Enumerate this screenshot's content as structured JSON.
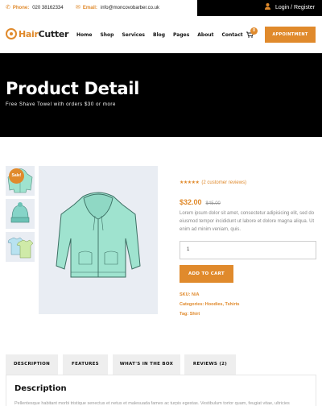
{
  "topbar": {
    "phone_label": "Phone:",
    "phone_value": "020 38162334",
    "email_label": "Email:",
    "email_value": "info@moncovobarber.co.uk",
    "login_text": "Login / Register"
  },
  "brand": {
    "name_part1": "Hair",
    "name_part2": "Cutter"
  },
  "nav": {
    "items": [
      "Home",
      "Shop",
      "Services",
      "Blog",
      "Pages",
      "About",
      "Contact"
    ],
    "cart_count": "0",
    "appointment_label": "APPOINTMENT"
  },
  "hero": {
    "title": "Product Detail",
    "subtitle": "Free Shave Towel with orders $30 or more"
  },
  "product": {
    "sale_badge": "Sale!",
    "stars": "★★★★★",
    "review_text": "(2 customer reviews)",
    "price": "$32.00",
    "old_price": "$45.00",
    "description": "Lorem ipsum dolor sit amet, consectetur adipisicing elit, sed do eiusmod tempor incididunt ut labore et dolore magna aliqua. Ut enim ad minim veniam, quis.",
    "quantity": "1",
    "add_to_cart_label": "ADD TO CART",
    "sku_label": "SKU:",
    "sku_value": "N/A",
    "categories_label": "Categories:",
    "categories_value": "Hoodies, Tshirts",
    "tag_label": "Tag:",
    "tag_value": "Shirt"
  },
  "tabs": {
    "items": [
      "DESCRIPTION",
      "FEATURES",
      "WHAT'S IN THE BOX",
      "REVIEWS (2)"
    ],
    "panel_title": "Description",
    "panel_text": "Pellentesque habitant morbi tristique senectus et netus et malesuada fames ac turpis egestas. Vestibulum tortor quam, feugiat vitae, ultricies"
  },
  "colors": {
    "accent": "#e08a2c",
    "hero_bg": "#000000",
    "image_bg": "#e9edf3",
    "hoodie": "#9fe3cf"
  },
  "icons": [
    "phone-icon",
    "email-icon",
    "user-icon",
    "cart-icon",
    "logo-icon"
  ]
}
